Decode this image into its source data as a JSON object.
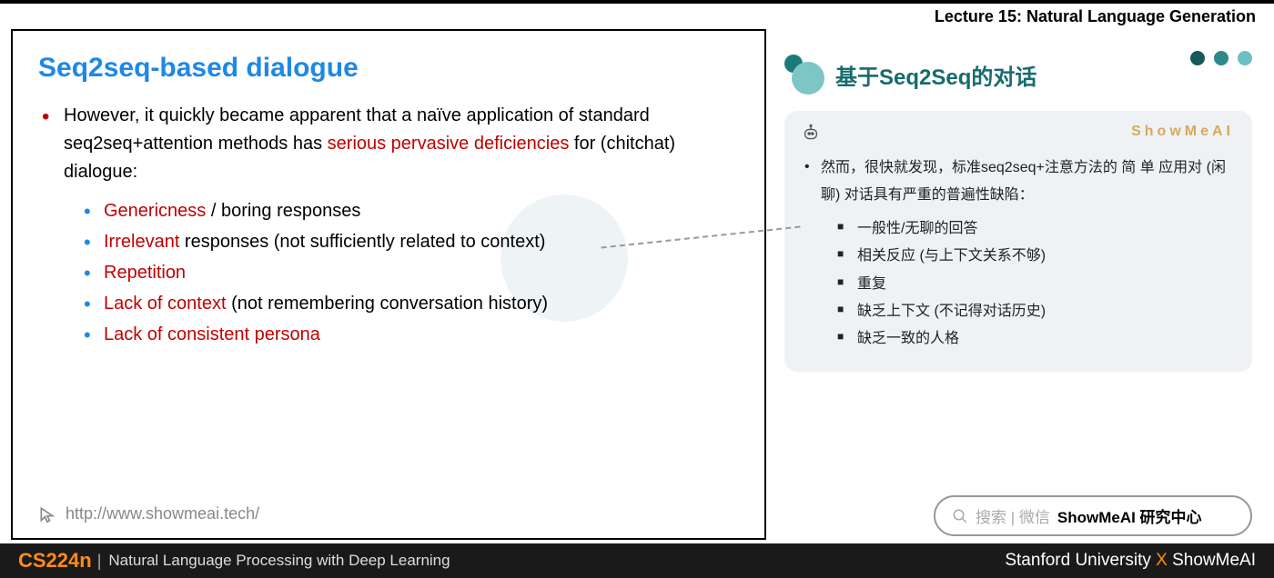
{
  "header": {
    "lecture": "Lecture 15: Natural Language Generation"
  },
  "slide": {
    "title": "Seq2seq-based dialogue",
    "main_pre": "However, it quickly became apparent that a naïve application of standard seq2seq+attention methods has ",
    "main_red": "serious pervasive deficiencies",
    "main_post": " for (chitchat) dialogue:",
    "bullets": [
      {
        "red": "Genericness",
        "rest": " / boring responses"
      },
      {
        "red": "Irrelevant",
        "rest": " responses (not sufficiently related to context)"
      },
      {
        "red": "Repetition",
        "rest": ""
      },
      {
        "red": "Lack of context",
        "rest": " (not remembering conversation history)"
      },
      {
        "red": "Lack of consistent persona",
        "rest": ""
      }
    ],
    "footer_url": "http://www.showmeai.tech/"
  },
  "right": {
    "title": "基于Seq2Seq的对话",
    "brand": "ShowMeAI",
    "main": "然而，很快就发现，标准seq2seq+注意方法的 简 单 应用对 (闲聊) 对话具有严重的普遍性缺陷：",
    "items": [
      "一般性/无聊的回答",
      "相关反应 (与上下文关系不够)",
      "重复",
      "缺乏上下文 (不记得对话历史)",
      "缺乏一致的人格"
    ]
  },
  "search": {
    "label": "搜索 | 微信 ",
    "bold": "ShowMeAI 研究中心"
  },
  "footer": {
    "code": "CS224n",
    "sep": "|",
    "name": "Natural Language Processing with Deep Learning",
    "right_a": "Stanford University ",
    "right_x": "X",
    "right_b": " ShowMeAI"
  }
}
